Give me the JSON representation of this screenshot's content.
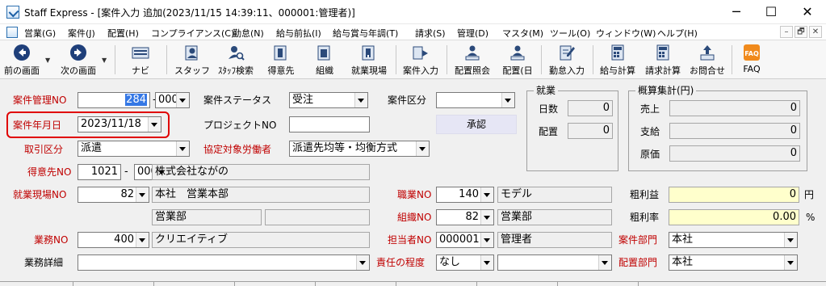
{
  "window": {
    "title": "Staff Express - [案件入力  追加(2023/11/15 14:39:11、000001:管理者)]",
    "minimize": "─",
    "maximize": "☐",
    "close": "✕"
  },
  "menu": {
    "items": [
      "営業(G)",
      "案件(J)",
      "配置(H)",
      "コンプライアンス(C)",
      "勤怠(N)",
      "給与前払(I)",
      "給与賞与年調(T)",
      "請求(S)",
      "管理(D)",
      "マスタ(M)",
      "ツール(O)",
      "ウィンドウ(W)",
      "ヘルプ(H)"
    ],
    "mdi": [
      "–",
      "🗗",
      "✕"
    ]
  },
  "toolbar": {
    "buttons": [
      "前の画面",
      "次の画面",
      "ナビ",
      "スタッフ",
      "ｽﾀｯﾌ検索",
      "得意先",
      "組織",
      "就業現場",
      "案件入力",
      "配置照会",
      "配置(日",
      "勤怠入力",
      "給与計算",
      "請求計算",
      "お問合せ",
      "FAQ"
    ],
    "faq_icon_text": "FAQ"
  },
  "form": {
    "labels": {
      "case_mgmt_no": "案件管理NO",
      "case_date": "案件年月日",
      "trade_type": "取引区分",
      "customer_no": "得意先NO",
      "worksite_no": "就業現場NO",
      "business_no": "業務NO",
      "business_detail": "業務詳細",
      "case_status": "案件ステータス",
      "project_no": "プロジェクトNO",
      "agreement_worker": "協定対象労働者",
      "case_type": "案件区分",
      "job_no": "職業NO",
      "org_no": "組織NO",
      "staff_no": "担当者NO",
      "responsibility": "責任の程度",
      "gross_profit": "粗利益",
      "gross_rate": "粗利率",
      "case_dept": "案件部門",
      "assign_dept": "配置部門"
    },
    "values": {
      "case_mgmt_no": "284",
      "case_mgmt_sub": "000",
      "case_date": "2023/11/18",
      "trade_type": "派遣",
      "customer_no": "1021",
      "customer_sub": "000",
      "customer_name": "株式会社ながの",
      "worksite_no": "82",
      "worksite_name": "本社　営業本部",
      "worksite_dept": "営業部",
      "worksite_extra": "",
      "business_no": "400",
      "business_name": "クリエイティブ",
      "business_detail": "",
      "case_status": "受注",
      "project_no": "",
      "agreement_worker": "派遣先均等・均衡方式",
      "case_type": "",
      "job_no": "140",
      "job_name": "モデル",
      "org_no": "82",
      "org_name": "営業部",
      "staff_no": "000001",
      "staff_name": "管理者",
      "responsibility": "なし",
      "responsibility_extra": "",
      "gross_profit": "0",
      "gross_rate": "0.00",
      "case_dept": "本社",
      "assign_dept": "本社"
    },
    "units": {
      "yen": "円",
      "percent": "%"
    },
    "approve_button": "承認",
    "dash": "-"
  },
  "employment": {
    "title": "就業",
    "days_label": "日数",
    "days_value": "0",
    "assign_label": "配置",
    "assign_value": "0"
  },
  "summary": {
    "title": "概算集計(円)",
    "sales_label": "売上",
    "sales_value": "0",
    "pay_label": "支給",
    "pay_value": "0",
    "cost_label": "原価",
    "cost_value": "0"
  }
}
